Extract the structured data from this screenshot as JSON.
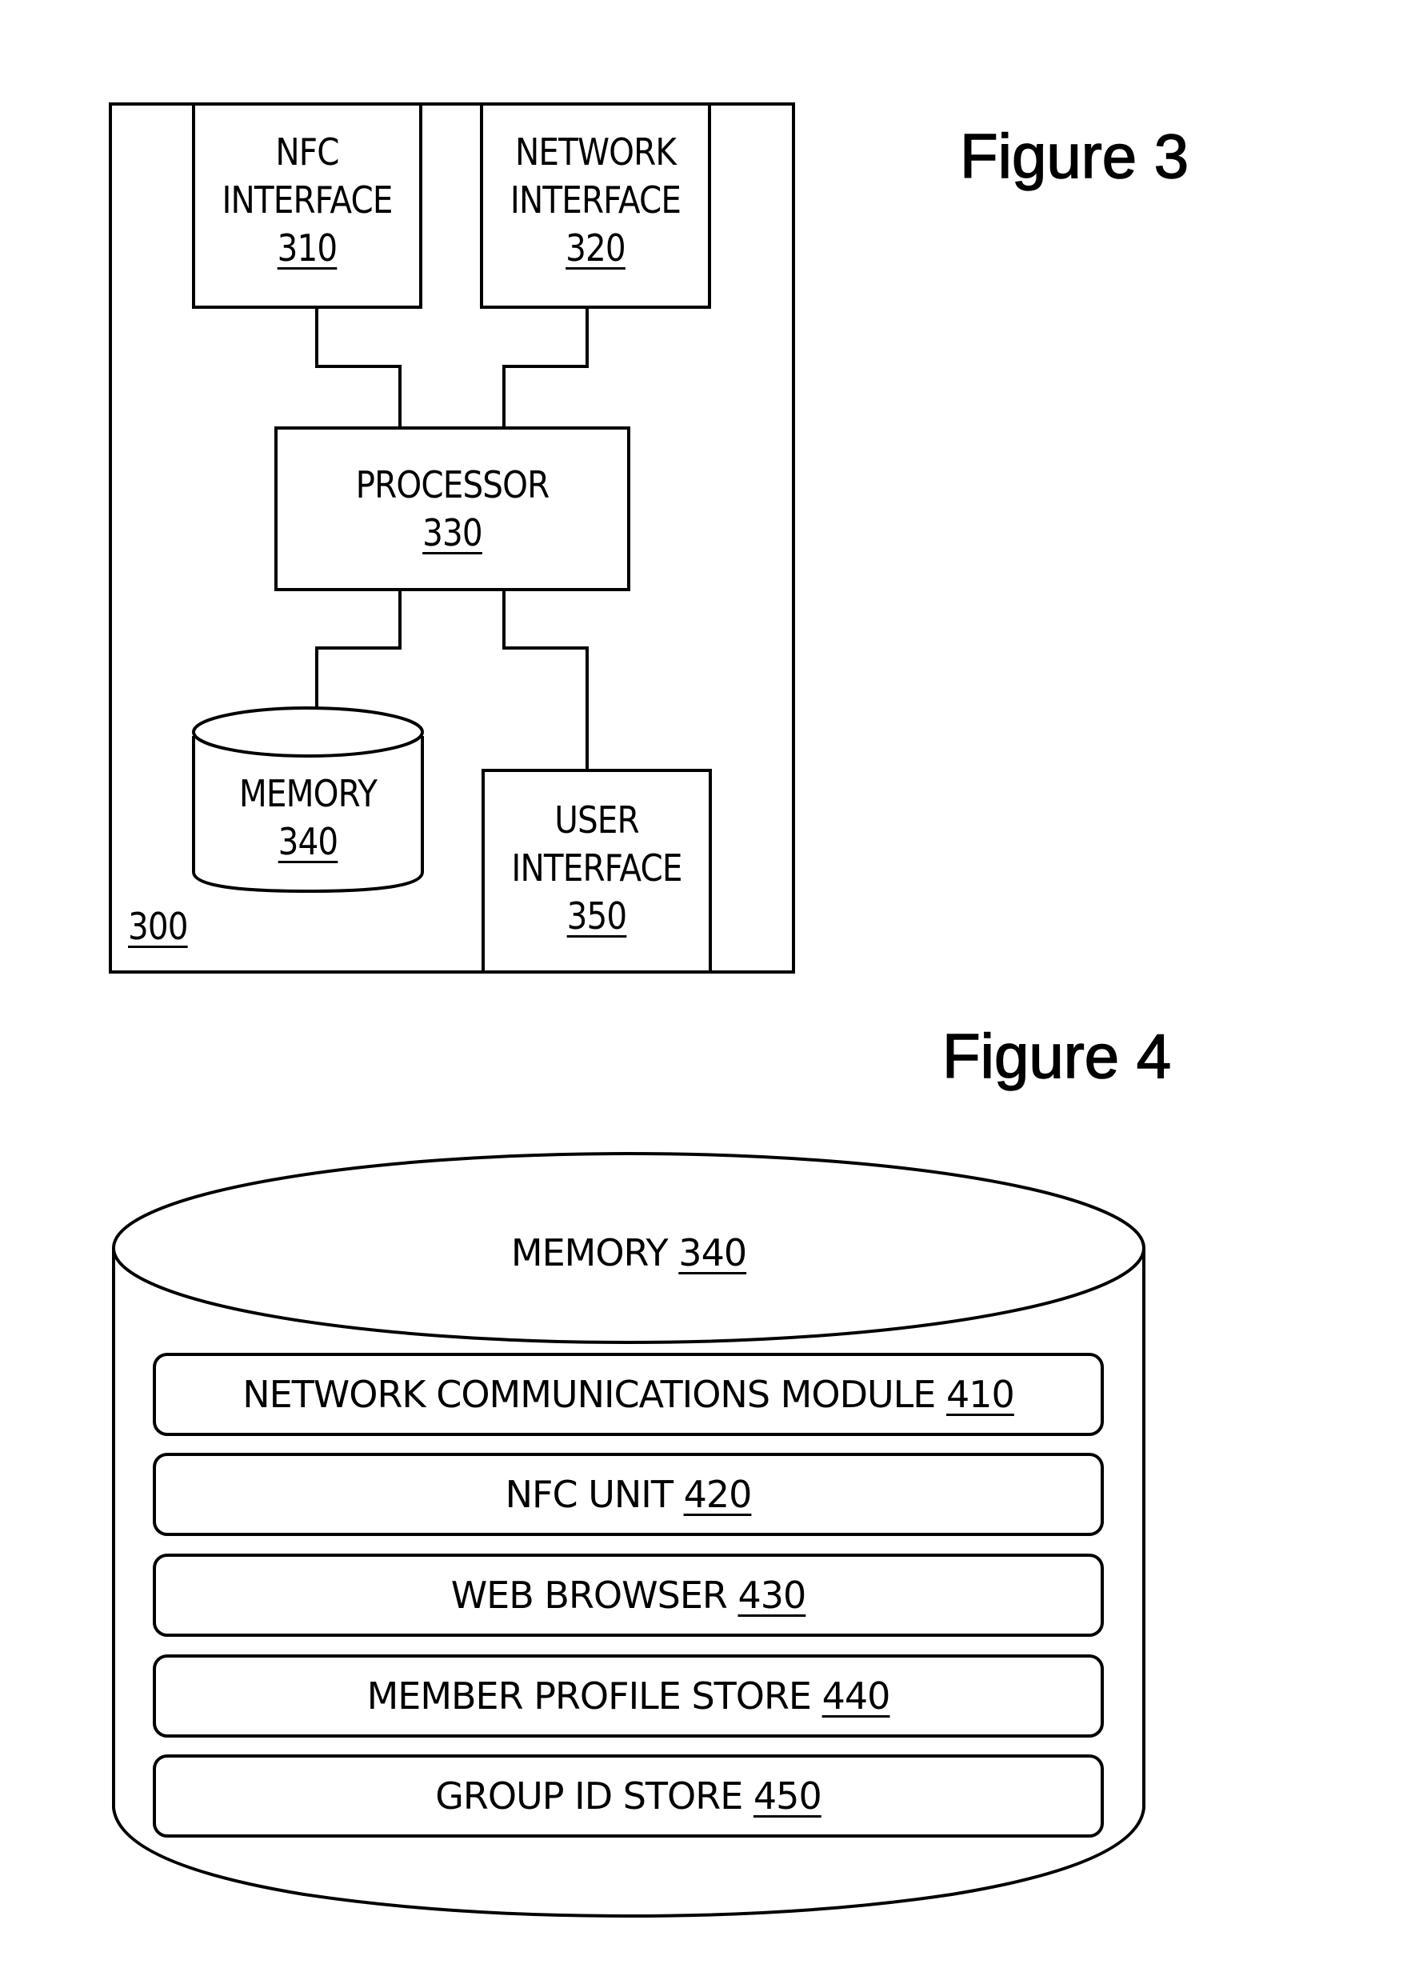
{
  "figure3": {
    "title": "Figure 3",
    "device": {
      "ref": "300"
    },
    "nfc_interface": {
      "lines": [
        "NFC",
        "INTERFACE"
      ],
      "ref": "310"
    },
    "network_interface": {
      "lines": [
        "NETWORK",
        "INTERFACE"
      ],
      "ref": "320"
    },
    "processor": {
      "lines": [
        "PROCESSOR"
      ],
      "ref": "330"
    },
    "memory": {
      "lines": [
        "MEMORY"
      ],
      "ref": "340"
    },
    "user_interface": {
      "lines": [
        "USER",
        "INTERFACE"
      ],
      "ref": "350"
    }
  },
  "figure4": {
    "title": "Figure 4",
    "memory": {
      "label": "MEMORY",
      "ref": "340"
    },
    "modules": [
      {
        "label": "NETWORK COMMUNICATIONS MODULE",
        "ref": "410"
      },
      {
        "label": "NFC UNIT",
        "ref": "420"
      },
      {
        "label": "WEB BROWSER",
        "ref": "430"
      },
      {
        "label": "MEMBER PROFILE STORE",
        "ref": "440"
      },
      {
        "label": "GROUP ID STORE",
        "ref": "450"
      }
    ]
  }
}
